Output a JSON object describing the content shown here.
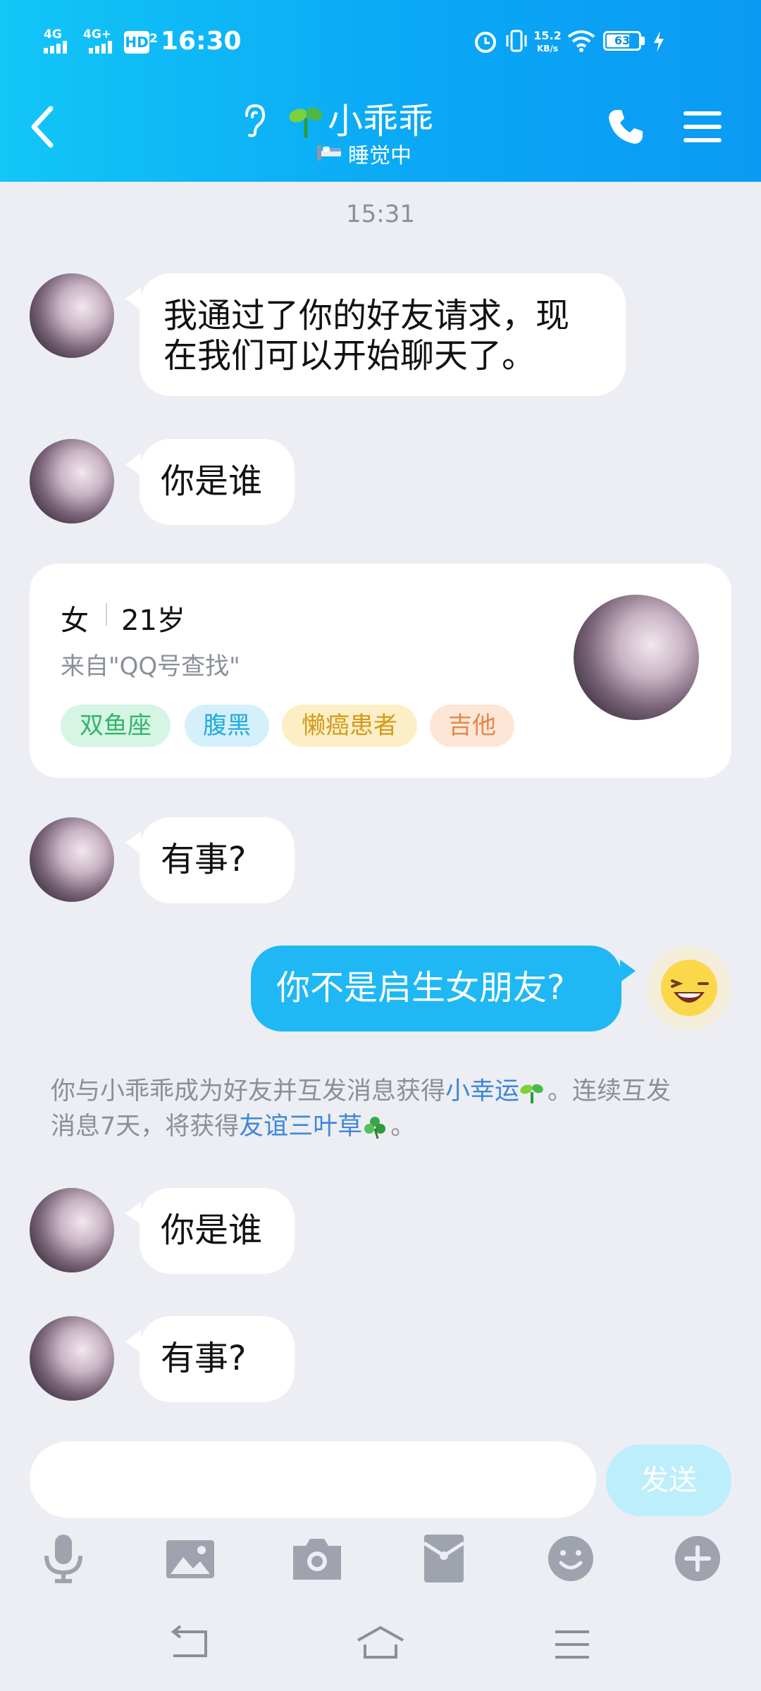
{
  "status_bar": {
    "net1": "4G",
    "net2": "4G+",
    "hd": "HD",
    "hd_sub": "2",
    "time": "16:30",
    "speed_value": "15.2",
    "speed_unit": "KB/s",
    "battery": "63"
  },
  "header": {
    "title": "小乖乖",
    "status": "睡觉中"
  },
  "chat": {
    "timestamp": "15:31",
    "msg1_line1": "我通过了你的好友请求，现",
    "msg1_line2": "在我们可以开始聊天了。",
    "msg2": "你是谁",
    "profile": {
      "gender": "女",
      "age": "21岁",
      "source": "来自\"QQ号查找\"",
      "tags": [
        "双鱼座",
        "腹黑",
        "懒癌患者",
        "吉他"
      ]
    },
    "msg3": "有事?",
    "msg4_me": "你不是启生女朋友?",
    "notice_a": "你与小乖乖成为好友并互发消息获得",
    "notice_link1": "小幸运",
    "notice_b": "。连续互发",
    "notice_c": "消息7天，将获得",
    "notice_link2": "友谊三叶草",
    "notice_d": "。",
    "msg5": "你是谁",
    "msg6": "有事?"
  },
  "input_bar": {
    "send_label": "发送"
  },
  "colors": {
    "header_start": "#12c6f7",
    "header_end": "#0b9af3",
    "my_bubble": "#1fb8f4",
    "link": "#3f86d8",
    "background": "#eceef4"
  }
}
